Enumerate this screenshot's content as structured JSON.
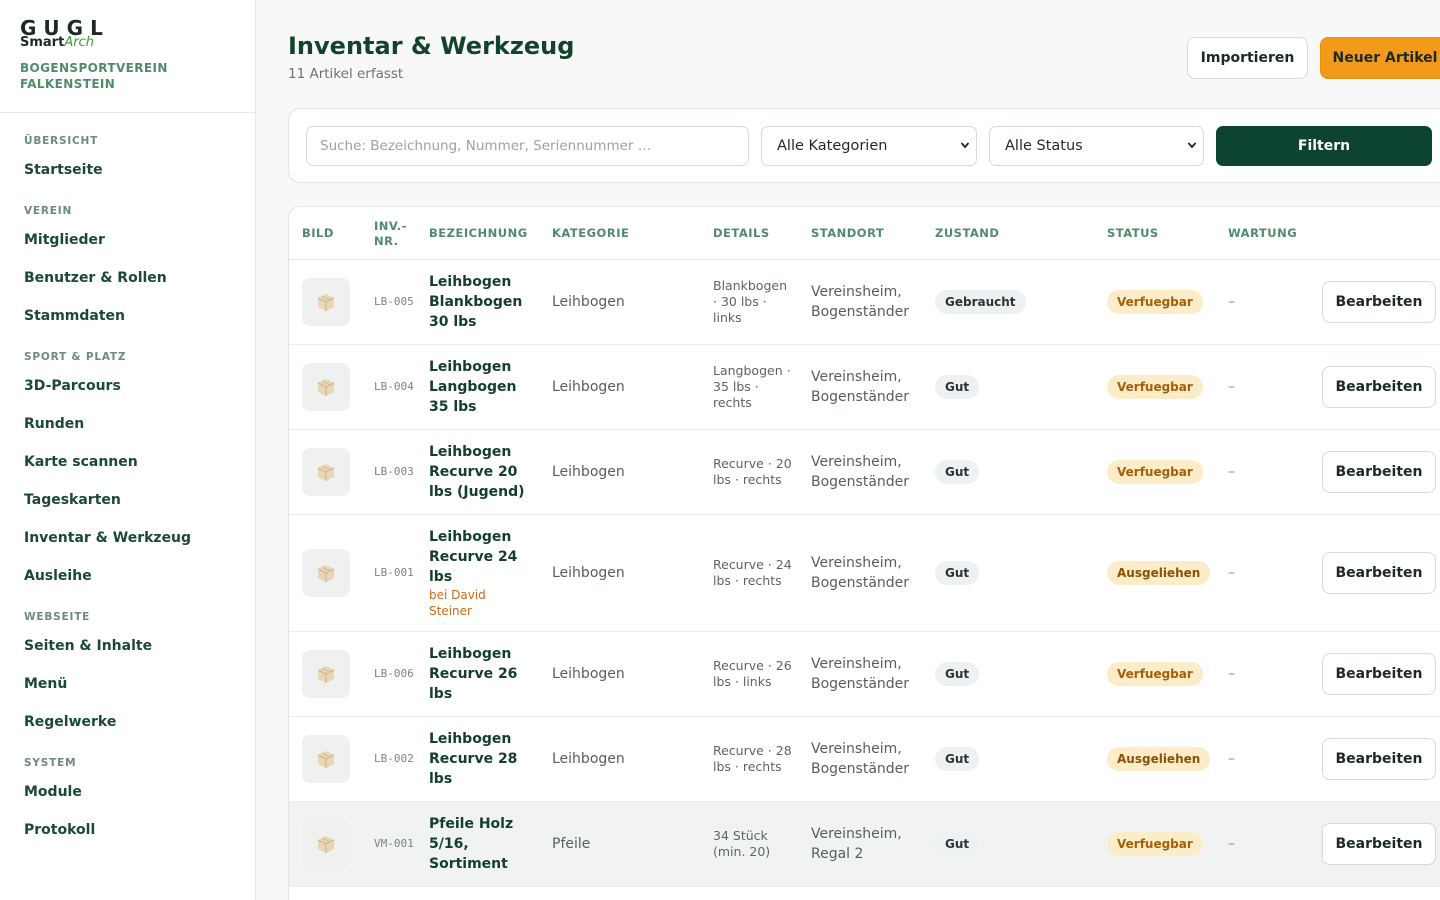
{
  "brand": {
    "logo_top": "GUGL",
    "logo_smart": "Smart",
    "logo_arch": "Arch",
    "club_line1": "BOGENSPORTVEREIN",
    "club_line2": "FALKENSTEIN"
  },
  "nav": {
    "uebersicht": {
      "title": "ÜBERSICHT",
      "items": [
        "Startseite"
      ]
    },
    "verein": {
      "title": "VEREIN",
      "items": [
        "Mitglieder",
        "Benutzer & Rollen",
        "Stammdaten"
      ]
    },
    "sport": {
      "title": "SPORT & PLATZ",
      "items": [
        "3D-Parcours",
        "Runden",
        "Karte scannen",
        "Tageskarten",
        "Inventar & Werkzeug",
        "Ausleihe"
      ]
    },
    "webseite": {
      "title": "WEBSEITE",
      "items": [
        "Seiten & Inhalte",
        "Menü",
        "Regelwerke"
      ]
    },
    "system": {
      "title": "SYSTEM",
      "items": [
        "Module",
        "Protokoll"
      ]
    }
  },
  "header": {
    "title": "Inventar & Werkzeug",
    "subtitle": "11 Artikel erfasst",
    "import_label": "Importieren",
    "new_label": "Neuer Artikel"
  },
  "filters": {
    "search_placeholder": "Suche: Bezeichnung, Nummer, Seriennummer …",
    "category_selected": "Alle Kategorien",
    "status_selected": "Alle Status",
    "filter_label": "Filtern"
  },
  "table": {
    "columns": {
      "bild": "BILD",
      "invnr": "INV.-NR.",
      "bezeichnung": "BEZEICHNUNG",
      "kategorie": "KATEGORIE",
      "details": "DETAILS",
      "standort": "STANDORT",
      "zustand": "ZUSTAND",
      "status": "STATUS",
      "wartung": "WARTUNG"
    },
    "edit_label": "Bearbeiten",
    "rows": [
      {
        "invnr": "LB-005",
        "name": "Leihbogen Blankbogen 30 lbs",
        "loan": "",
        "category": "Leihbogen",
        "details": "Blankbogen · 30 lbs · links",
        "location": "Vereinsheim, Bogenständer",
        "condition": "Gebraucht",
        "status": "Verfuegbar",
        "maintenance": "–"
      },
      {
        "invnr": "LB-004",
        "name": "Leihbogen Langbogen 35 lbs",
        "loan": "",
        "category": "Leihbogen",
        "details": "Langbogen · 35 lbs · rechts",
        "location": "Vereinsheim, Bogenständer",
        "condition": "Gut",
        "status": "Verfuegbar",
        "maintenance": "–"
      },
      {
        "invnr": "LB-003",
        "name": "Leihbogen Recurve 20 lbs (Jugend)",
        "loan": "",
        "category": "Leihbogen",
        "details": "Recurve · 20 lbs · rechts",
        "location": "Vereinsheim, Bogenständer",
        "condition": "Gut",
        "status": "Verfuegbar",
        "maintenance": "–"
      },
      {
        "invnr": "LB-001",
        "name": "Leihbogen Recurve 24 lbs",
        "loan": "bei David Steiner",
        "category": "Leihbogen",
        "details": "Recurve · 24 lbs · rechts",
        "location": "Vereinsheim, Bogenständer",
        "condition": "Gut",
        "status": "Ausgeliehen",
        "maintenance": "–"
      },
      {
        "invnr": "LB-006",
        "name": "Leihbogen Recurve 26 lbs",
        "loan": "",
        "category": "Leihbogen",
        "details": "Recurve · 26 lbs · links",
        "location": "Vereinsheim, Bogenständer",
        "condition": "Gut",
        "status": "Verfuegbar",
        "maintenance": "–"
      },
      {
        "invnr": "LB-002",
        "name": "Leihbogen Recurve 28 lbs",
        "loan": "",
        "category": "Leihbogen",
        "details": "Recurve · 28 lbs · rechts",
        "location": "Vereinsheim, Bogenständer",
        "condition": "Gut",
        "status": "Ausgeliehen",
        "maintenance": "–"
      },
      {
        "invnr": "VM-001",
        "name": "Pfeile Holz 5/16, Sortiment",
        "loan": "",
        "category": "Pfeile",
        "details": "34 Stück (min. 20)",
        "location": "Vereinsheim, Regal 2",
        "condition": "Gut",
        "status": "Verfuegbar",
        "maintenance": "–"
      }
    ]
  }
}
